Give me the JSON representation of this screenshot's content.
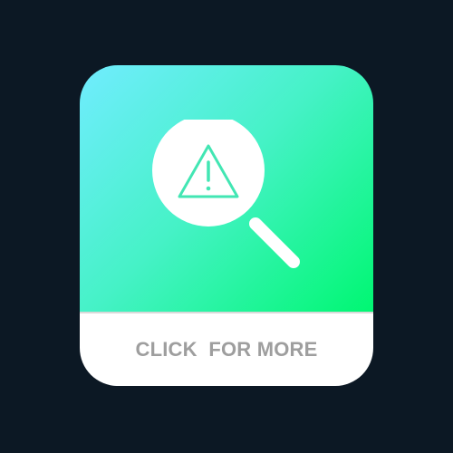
{
  "card": {
    "cta_label": "CLICK  FOR MORE"
  },
  "icon": {
    "name": "search-warning-icon"
  },
  "colors": {
    "background": "#0c1824",
    "gradient_start": "#71ecff",
    "gradient_end": "#00f772",
    "card_bottom": "#ffffff",
    "cta_text": "#9e9e9e"
  }
}
